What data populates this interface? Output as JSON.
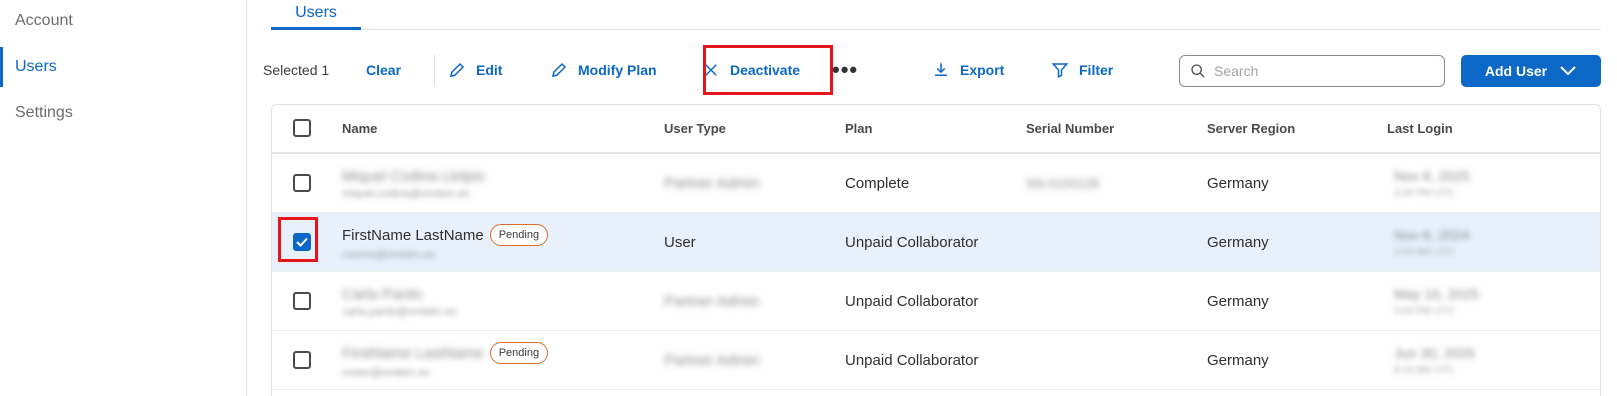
{
  "sidebar": {
    "items": [
      {
        "label": "Account",
        "active": false
      },
      {
        "label": "Users",
        "active": true
      },
      {
        "label": "Settings",
        "active": false
      }
    ]
  },
  "tabs": [
    {
      "label": "Users",
      "active": true
    }
  ],
  "toolbar": {
    "selected_text": "Selected 1",
    "clear_label": "Clear",
    "edit_label": "Edit",
    "modify_plan_label": "Modify Plan",
    "deactivate_label": "Deactivate",
    "more_label": "•••",
    "export_label": "Export",
    "filter_label": "Filter",
    "search_placeholder": "Search",
    "add_user_label": "Add User"
  },
  "table": {
    "columns": [
      "Name",
      "User Type",
      "Plan",
      "Serial Number",
      "Server Region",
      "Last Login"
    ],
    "rows": [
      {
        "name": "Miquel Codina Llelpis",
        "email": "miquel.codina@ombtm.es",
        "pending": false,
        "user_type": "Partner Admin",
        "plan": "Complete",
        "serial": "SN-0150128",
        "region": "Germany",
        "last_login_date": "Nov 6, 2025",
        "last_login_time": "3:34 PM UTC",
        "checked": false
      },
      {
        "name": "FirstName LastName",
        "email": "marina@ombtm.es",
        "pending": true,
        "pending_label": "Pending",
        "user_type": "User",
        "plan": "Unpaid Collaborator",
        "serial": "",
        "region": "Germany",
        "last_login_date": "Nov 6, 2024",
        "last_login_time": "3:03 AM UTC",
        "checked": true
      },
      {
        "name": "Carla Pardo",
        "email": "carla.pardo@ombtm.es",
        "pending": false,
        "user_type": "Partner Admin",
        "plan": "Unpaid Collaborator",
        "serial": "",
        "region": "Germany",
        "last_login_date": "May 10, 2025",
        "last_login_time": "3:03 PM UTC",
        "checked": false
      },
      {
        "name": "FirstName LastName",
        "email": "roster@ombtm.es",
        "pending": true,
        "pending_label": "Pending",
        "user_type": "Partner Admin",
        "plan": "Unpaid Collaborator",
        "serial": "",
        "region": "Germany",
        "last_login_date": "Jun 30, 2025",
        "last_login_time": "8:15 AM UTC",
        "checked": false
      }
    ]
  },
  "colors": {
    "accent": "#0b68c6",
    "highlight": "#e8141b",
    "pending_border": "#e06a2a",
    "selected_row": "#e8f1fb"
  }
}
